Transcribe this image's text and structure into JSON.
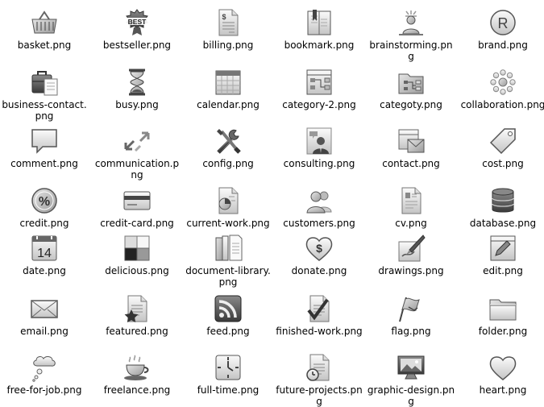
{
  "files": [
    {
      "name": "basket.png",
      "icon": "basket-icon"
    },
    {
      "name": "bestseller.png",
      "icon": "bestseller-icon",
      "icon_text": "BEST"
    },
    {
      "name": "billing.png",
      "icon": "billing-icon"
    },
    {
      "name": "bookmark.png",
      "icon": "bookmark-icon"
    },
    {
      "name": "brainstorming.png",
      "icon": "brainstorming-icon"
    },
    {
      "name": "brand.png",
      "icon": "brand-icon",
      "icon_text": "R"
    },
    {
      "name": "business-contact.png",
      "icon": "business-contact-icon"
    },
    {
      "name": "busy.png",
      "icon": "busy-icon"
    },
    {
      "name": "calendar.png",
      "icon": "calendar-icon"
    },
    {
      "name": "category-2.png",
      "icon": "category-2-icon"
    },
    {
      "name": "categoty.png",
      "icon": "category-icon"
    },
    {
      "name": "collaboration.png",
      "icon": "collaboration-icon"
    },
    {
      "name": "comment.png",
      "icon": "comment-icon"
    },
    {
      "name": "communication.png",
      "icon": "communication-icon"
    },
    {
      "name": "config.png",
      "icon": "config-icon"
    },
    {
      "name": "consulting.png",
      "icon": "consulting-icon"
    },
    {
      "name": "contact.png",
      "icon": "contact-icon"
    },
    {
      "name": "cost.png",
      "icon": "cost-icon"
    },
    {
      "name": "credit.png",
      "icon": "credit-icon",
      "icon_text": "%"
    },
    {
      "name": "credit-card.png",
      "icon": "credit-card-icon"
    },
    {
      "name": "current-work.png",
      "icon": "current-work-icon"
    },
    {
      "name": "customers.png",
      "icon": "customers-icon"
    },
    {
      "name": "cv.png",
      "icon": "cv-icon"
    },
    {
      "name": "database.png",
      "icon": "database-icon"
    },
    {
      "name": "date.png",
      "icon": "date-icon",
      "icon_text": "14"
    },
    {
      "name": "delicious.png",
      "icon": "delicious-icon"
    },
    {
      "name": "document-library.png",
      "icon": "document-library-icon"
    },
    {
      "name": "donate.png",
      "icon": "donate-icon",
      "icon_text": "$"
    },
    {
      "name": "drawings.png",
      "icon": "drawings-icon"
    },
    {
      "name": "edit.png",
      "icon": "edit-icon"
    },
    {
      "name": "email.png",
      "icon": "email-icon"
    },
    {
      "name": "featured.png",
      "icon": "featured-icon"
    },
    {
      "name": "feed.png",
      "icon": "feed-icon"
    },
    {
      "name": "finished-work.png",
      "icon": "finished-work-icon"
    },
    {
      "name": "flag.png",
      "icon": "flag-icon"
    },
    {
      "name": "folder.png",
      "icon": "folder-icon"
    },
    {
      "name": "free-for-job.png",
      "icon": "free-for-job-icon"
    },
    {
      "name": "freelance.png",
      "icon": "freelance-icon"
    },
    {
      "name": "full-time.png",
      "icon": "full-time-icon"
    },
    {
      "name": "future-projects.png",
      "icon": "future-projects-icon"
    },
    {
      "name": "graphic-design.png",
      "icon": "graphic-design-icon"
    },
    {
      "name": "heart.png",
      "icon": "heart-icon"
    }
  ]
}
